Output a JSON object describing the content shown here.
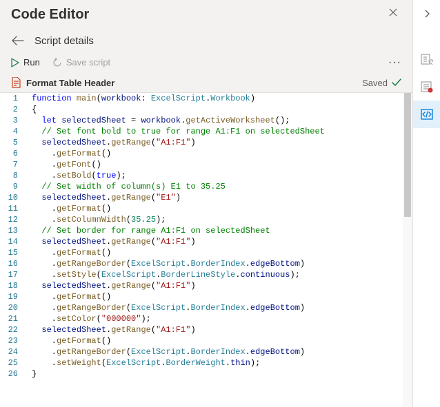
{
  "header": {
    "title": "Code Editor"
  },
  "subtitle": "Script details",
  "toolbar": {
    "run_label": "Run",
    "save_label": "Save script",
    "more_label": "···"
  },
  "script": {
    "name": "Format Table Header",
    "saved_label": "Saved"
  },
  "rail": {
    "expand": "›",
    "item1": "sheet-link",
    "item2": "record",
    "item3": "code-editor"
  },
  "code_lines": [
    {
      "n": "1",
      "tokens": [
        [
          "kw",
          "function"
        ],
        [
          "plain",
          " "
        ],
        [
          "fn",
          "main"
        ],
        [
          "plain",
          "("
        ],
        [
          "id",
          "workbook"
        ],
        [
          "plain",
          ": "
        ],
        [
          "type",
          "ExcelScript"
        ],
        [
          "plain",
          "."
        ],
        [
          "type",
          "Workbook"
        ],
        [
          "plain",
          ")"
        ]
      ]
    },
    {
      "n": "2",
      "tokens": [
        [
          "plain",
          "{"
        ]
      ]
    },
    {
      "n": "3",
      "tokens": [
        [
          "plain",
          "  "
        ],
        [
          "kw",
          "let"
        ],
        [
          "plain",
          " "
        ],
        [
          "id",
          "selectedSheet"
        ],
        [
          "plain",
          " = "
        ],
        [
          "id",
          "workbook"
        ],
        [
          "plain",
          "."
        ],
        [
          "fn",
          "getActiveWorksheet"
        ],
        [
          "plain",
          "();"
        ]
      ]
    },
    {
      "n": "4",
      "tokens": [
        [
          "plain",
          "  "
        ],
        [
          "cm",
          "// Set font bold to true for range A1:F1 on selectedSheet"
        ]
      ]
    },
    {
      "n": "5",
      "tokens": [
        [
          "plain",
          "  "
        ],
        [
          "id",
          "selectedSheet"
        ],
        [
          "plain",
          "."
        ],
        [
          "fn",
          "getRange"
        ],
        [
          "plain",
          "("
        ],
        [
          "str",
          "\"A1:F1\""
        ],
        [
          "plain",
          ")"
        ]
      ]
    },
    {
      "n": "6",
      "tokens": [
        [
          "plain",
          "    ."
        ],
        [
          "fn",
          "getFormat"
        ],
        [
          "plain",
          "()"
        ]
      ]
    },
    {
      "n": "7",
      "tokens": [
        [
          "plain",
          "    ."
        ],
        [
          "fn",
          "getFont"
        ],
        [
          "plain",
          "()"
        ]
      ]
    },
    {
      "n": "8",
      "tokens": [
        [
          "plain",
          "    ."
        ],
        [
          "fn",
          "setBold"
        ],
        [
          "plain",
          "("
        ],
        [
          "kw",
          "true"
        ],
        [
          "plain",
          ");"
        ]
      ]
    },
    {
      "n": "9",
      "tokens": [
        [
          "plain",
          "  "
        ],
        [
          "cm",
          "// Set width of column(s) E1 to 35.25"
        ]
      ]
    },
    {
      "n": "10",
      "tokens": [
        [
          "plain",
          "  "
        ],
        [
          "id",
          "selectedSheet"
        ],
        [
          "plain",
          "."
        ],
        [
          "fn",
          "getRange"
        ],
        [
          "plain",
          "("
        ],
        [
          "str",
          "\"E1\""
        ],
        [
          "plain",
          ")"
        ]
      ]
    },
    {
      "n": "11",
      "tokens": [
        [
          "plain",
          "    ."
        ],
        [
          "fn",
          "getFormat"
        ],
        [
          "plain",
          "()"
        ]
      ]
    },
    {
      "n": "12",
      "tokens": [
        [
          "plain",
          "    ."
        ],
        [
          "fn",
          "setColumnWidth"
        ],
        [
          "plain",
          "("
        ],
        [
          "num",
          "35.25"
        ],
        [
          "plain",
          ");"
        ]
      ]
    },
    {
      "n": "13",
      "tokens": [
        [
          "plain",
          "  "
        ],
        [
          "cm",
          "// Set border for range A1:F1 on selectedSheet"
        ]
      ]
    },
    {
      "n": "14",
      "tokens": [
        [
          "plain",
          "  "
        ],
        [
          "id",
          "selectedSheet"
        ],
        [
          "plain",
          "."
        ],
        [
          "fn",
          "getRange"
        ],
        [
          "plain",
          "("
        ],
        [
          "str",
          "\"A1:F1\""
        ],
        [
          "plain",
          ")"
        ]
      ]
    },
    {
      "n": "15",
      "tokens": [
        [
          "plain",
          "    ."
        ],
        [
          "fn",
          "getFormat"
        ],
        [
          "plain",
          "()"
        ]
      ]
    },
    {
      "n": "16",
      "tokens": [
        [
          "plain",
          "    ."
        ],
        [
          "fn",
          "getRangeBorder"
        ],
        [
          "plain",
          "("
        ],
        [
          "type",
          "ExcelScript"
        ],
        [
          "plain",
          "."
        ],
        [
          "type",
          "BorderIndex"
        ],
        [
          "plain",
          "."
        ],
        [
          "id",
          "edgeBottom"
        ],
        [
          "plain",
          ")"
        ]
      ]
    },
    {
      "n": "17",
      "tokens": [
        [
          "plain",
          "    ."
        ],
        [
          "fn",
          "setStyle"
        ],
        [
          "plain",
          "("
        ],
        [
          "type",
          "ExcelScript"
        ],
        [
          "plain",
          "."
        ],
        [
          "type",
          "BorderLineStyle"
        ],
        [
          "plain",
          "."
        ],
        [
          "id",
          "continuous"
        ],
        [
          "plain",
          ");"
        ]
      ]
    },
    {
      "n": "18",
      "tokens": [
        [
          "plain",
          "  "
        ],
        [
          "id",
          "selectedSheet"
        ],
        [
          "plain",
          "."
        ],
        [
          "fn",
          "getRange"
        ],
        [
          "plain",
          "("
        ],
        [
          "str",
          "\"A1:F1\""
        ],
        [
          "plain",
          ")"
        ]
      ]
    },
    {
      "n": "19",
      "tokens": [
        [
          "plain",
          "    ."
        ],
        [
          "fn",
          "getFormat"
        ],
        [
          "plain",
          "()"
        ]
      ]
    },
    {
      "n": "20",
      "tokens": [
        [
          "plain",
          "    ."
        ],
        [
          "fn",
          "getRangeBorder"
        ],
        [
          "plain",
          "("
        ],
        [
          "type",
          "ExcelScript"
        ],
        [
          "plain",
          "."
        ],
        [
          "type",
          "BorderIndex"
        ],
        [
          "plain",
          "."
        ],
        [
          "id",
          "edgeBottom"
        ],
        [
          "plain",
          ")"
        ]
      ]
    },
    {
      "n": "21",
      "tokens": [
        [
          "plain",
          "    ."
        ],
        [
          "fn",
          "setColor"
        ],
        [
          "plain",
          "("
        ],
        [
          "str",
          "\"000000\""
        ],
        [
          "plain",
          ");"
        ]
      ]
    },
    {
      "n": "22",
      "tokens": [
        [
          "plain",
          "  "
        ],
        [
          "id",
          "selectedSheet"
        ],
        [
          "plain",
          "."
        ],
        [
          "fn",
          "getRange"
        ],
        [
          "plain",
          "("
        ],
        [
          "str",
          "\"A1:F1\""
        ],
        [
          "plain",
          ")"
        ]
      ]
    },
    {
      "n": "23",
      "tokens": [
        [
          "plain",
          "    ."
        ],
        [
          "fn",
          "getFormat"
        ],
        [
          "plain",
          "()"
        ]
      ]
    },
    {
      "n": "24",
      "tokens": [
        [
          "plain",
          "    ."
        ],
        [
          "fn",
          "getRangeBorder"
        ],
        [
          "plain",
          "("
        ],
        [
          "type",
          "ExcelScript"
        ],
        [
          "plain",
          "."
        ],
        [
          "type",
          "BorderIndex"
        ],
        [
          "plain",
          "."
        ],
        [
          "id",
          "edgeBottom"
        ],
        [
          "plain",
          ")"
        ]
      ]
    },
    {
      "n": "25",
      "tokens": [
        [
          "plain",
          "    ."
        ],
        [
          "fn",
          "setWeight"
        ],
        [
          "plain",
          "("
        ],
        [
          "type",
          "ExcelScript"
        ],
        [
          "plain",
          "."
        ],
        [
          "type",
          "BorderWeight"
        ],
        [
          "plain",
          "."
        ],
        [
          "id",
          "thin"
        ],
        [
          "plain",
          ");"
        ]
      ]
    },
    {
      "n": "26",
      "tokens": [
        [
          "plain",
          "}"
        ]
      ]
    }
  ]
}
